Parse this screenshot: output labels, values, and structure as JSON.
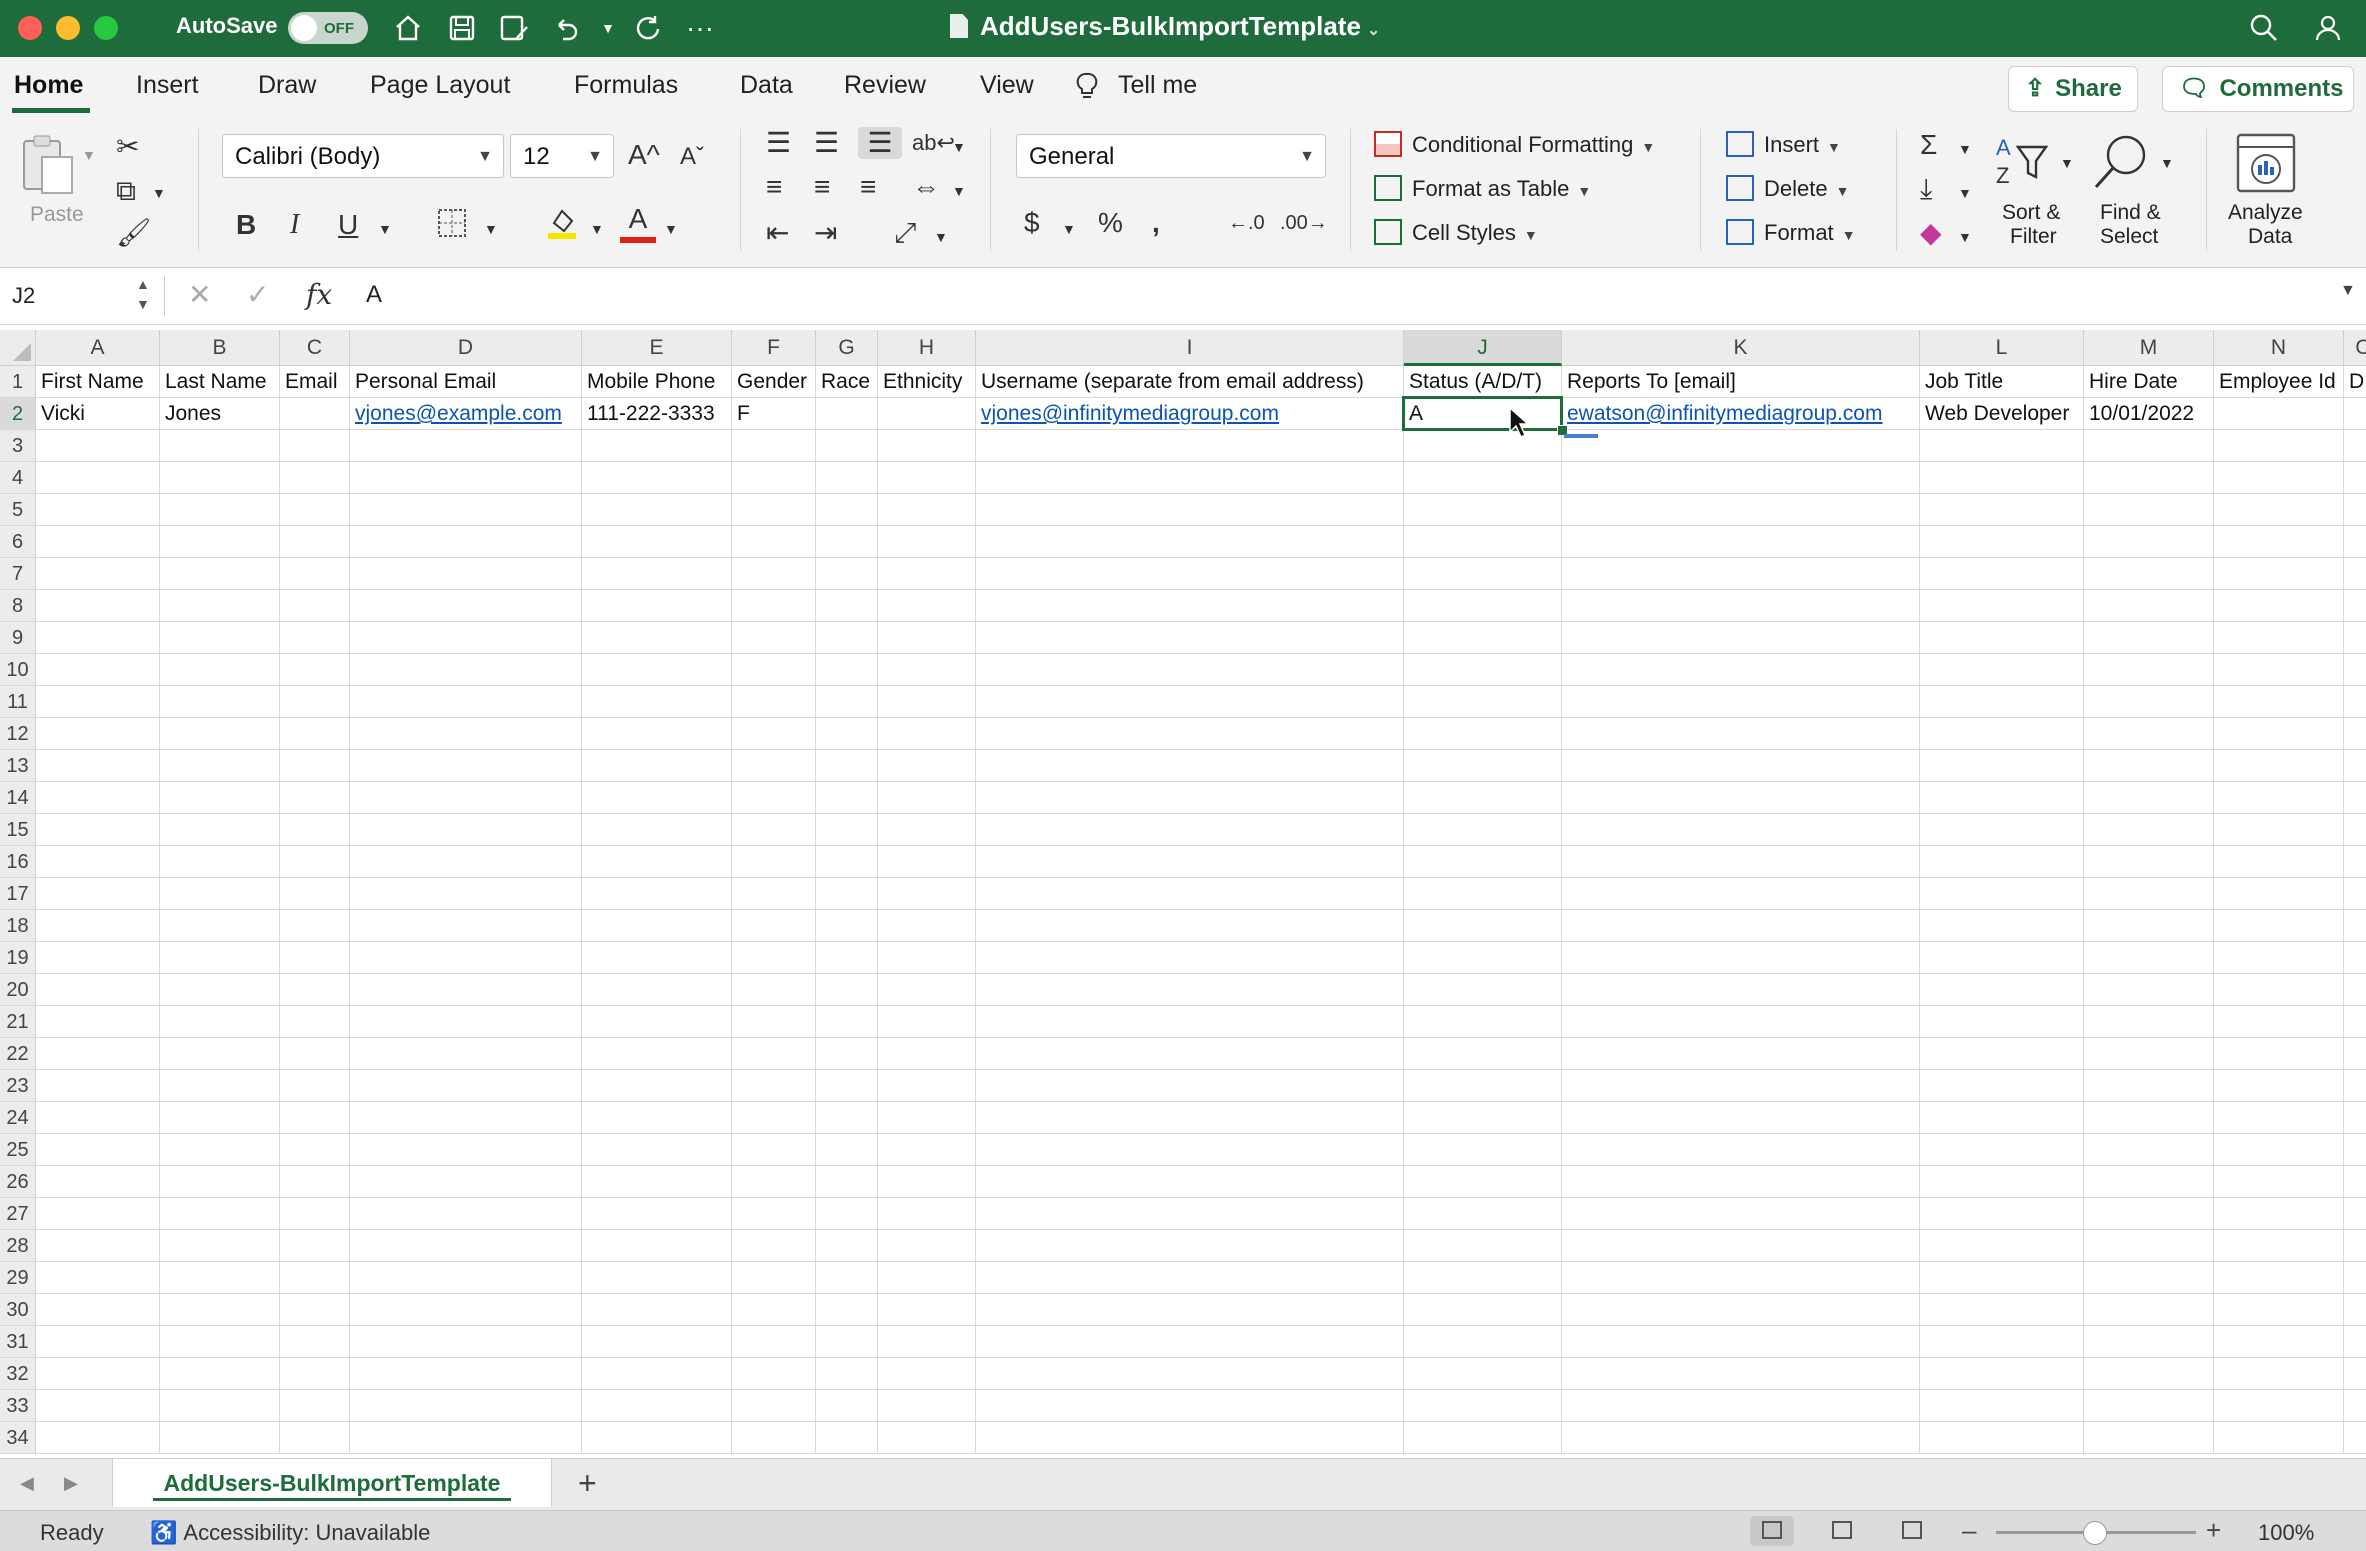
{
  "titlebar": {
    "autosave_label": "AutoSave",
    "autosave_state": "OFF",
    "document_title": "AddUsers-BulkImportTemplate"
  },
  "ribbon_tabs": [
    "Home",
    "Insert",
    "Draw",
    "Page Layout",
    "Formulas",
    "Data",
    "Review",
    "View",
    "Tell me"
  ],
  "share_label": "Share",
  "comments_label": "Comments",
  "ribbon": {
    "paste_label": "Paste",
    "font_name": "Calibri (Body)",
    "font_size": "12",
    "number_format": "General",
    "conditional_formatting": "Conditional Formatting",
    "format_as_table": "Format as Table",
    "cell_styles": "Cell Styles",
    "insert": "Insert",
    "delete": "Delete",
    "format": "Format",
    "sort_filter_1": "Sort &",
    "sort_filter_2": "Filter",
    "find_select_1": "Find &",
    "find_select_2": "Select",
    "analyze_1": "Analyze",
    "analyze_2": "Data",
    "bold": "B",
    "italic": "I",
    "underline": "U",
    "font_color_glyph": "A",
    "grow_font": "A^",
    "shrink_font": "Aˇ"
  },
  "formula_bar": {
    "name_box": "J2",
    "fx": "fx",
    "content": "A"
  },
  "grid": {
    "columns": [
      {
        "letter": "A"
      },
      {
        "letter": "B"
      },
      {
        "letter": "C"
      },
      {
        "letter": "D"
      },
      {
        "letter": "E"
      },
      {
        "letter": "F"
      },
      {
        "letter": "G"
      },
      {
        "letter": "H"
      },
      {
        "letter": "I"
      },
      {
        "letter": "J"
      },
      {
        "letter": "K"
      },
      {
        "letter": "L"
      },
      {
        "letter": "M"
      },
      {
        "letter": "N"
      },
      {
        "letter": "O"
      }
    ],
    "selected_column": "J",
    "selected_row": "2",
    "row_numbers": [
      "1",
      "2",
      "3",
      "4",
      "5",
      "6",
      "7",
      "8",
      "9",
      "10",
      "11",
      "12",
      "13",
      "14",
      "15",
      "16",
      "17",
      "18",
      "19",
      "20",
      "21",
      "22",
      "23",
      "24",
      "25",
      "26",
      "27",
      "28",
      "29",
      "30",
      "31",
      "32",
      "33",
      "34"
    ],
    "headers": [
      "First Name",
      "Last Name",
      "Email",
      "Personal Email",
      "Mobile Phone",
      "Gender",
      "Race",
      "Ethnicity",
      "Username (separate from email address)",
      "Status (A/D/T)",
      "Reports To [email]",
      "Job Title",
      "Hire Date",
      "Employee Id",
      "D"
    ],
    "row2": [
      "Vicki",
      "Jones",
      "",
      "vjones@example.com",
      "111-222-3333",
      "F",
      "",
      "",
      "vjones@infinitymediagroup.com",
      "A",
      "ewatson@infinitymediagroup.com",
      "Web Developer",
      "10/01/2022",
      "",
      ""
    ]
  },
  "sheet_tabs": [
    "AddUsers-BulkImportTemplate"
  ],
  "statusbar": {
    "ready": "Ready",
    "accessibility": "Accessibility: Unavailable",
    "zoom": "100%"
  },
  "colors": {
    "excel_green": "#1e6b3b",
    "link_blue": "#0b54b0"
  }
}
